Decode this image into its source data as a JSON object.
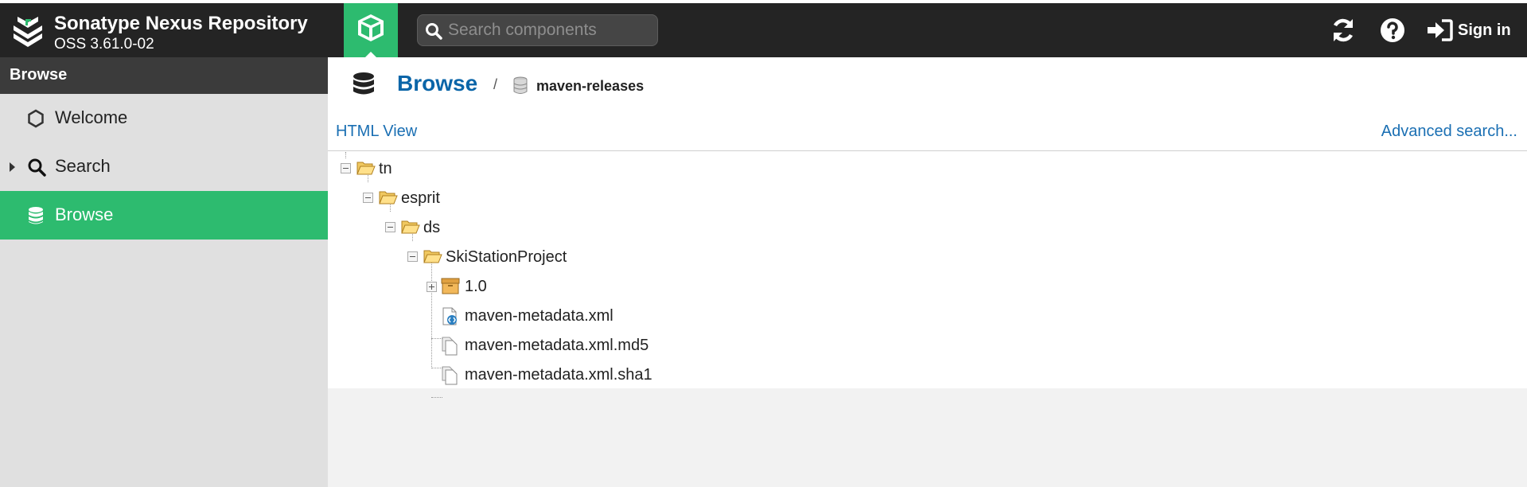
{
  "app": {
    "title": "Sonatype Nexus Repository",
    "version": "OSS 3.61.0-02",
    "search_placeholder": "Search components",
    "sign_in_label": "Sign in"
  },
  "sidebar": {
    "header": "Browse",
    "items": [
      {
        "label": "Welcome",
        "icon": "hexagon-icon",
        "active": false
      },
      {
        "label": "Search",
        "icon": "search-icon",
        "active": false,
        "expandable": true
      },
      {
        "label": "Browse",
        "icon": "database-icon",
        "active": true
      }
    ]
  },
  "main": {
    "breadcrumb": {
      "title": "Browse",
      "separator": "/",
      "repository": "maven-releases"
    },
    "toolbar": {
      "html_view": "HTML View",
      "advanced_search": "Advanced search..."
    },
    "tree": [
      {
        "label": "tn",
        "icon": "folder-open-icon",
        "depth": 0,
        "toggle": "minus"
      },
      {
        "label": "esprit",
        "icon": "folder-open-icon",
        "depth": 1,
        "toggle": "minus"
      },
      {
        "label": "ds",
        "icon": "folder-open-icon",
        "depth": 2,
        "toggle": "minus"
      },
      {
        "label": "SkiStationProject",
        "icon": "folder-open-icon",
        "depth": 3,
        "toggle": "minus"
      },
      {
        "label": "1.0",
        "icon": "package-icon",
        "depth": 4,
        "toggle": "plus"
      },
      {
        "label": "maven-metadata.xml",
        "icon": "xml-file-icon",
        "depth": 4,
        "toggle": "none"
      },
      {
        "label": "maven-metadata.xml.md5",
        "icon": "file-icon",
        "depth": 4,
        "toggle": "none"
      },
      {
        "label": "maven-metadata.xml.sha1",
        "icon": "file-icon",
        "depth": 4,
        "toggle": "none"
      }
    ]
  },
  "colors": {
    "header_bg": "#242424",
    "accent_green": "#2dbb6f",
    "link_blue": "#1a6fb3",
    "title_blue": "#0a65a8"
  }
}
